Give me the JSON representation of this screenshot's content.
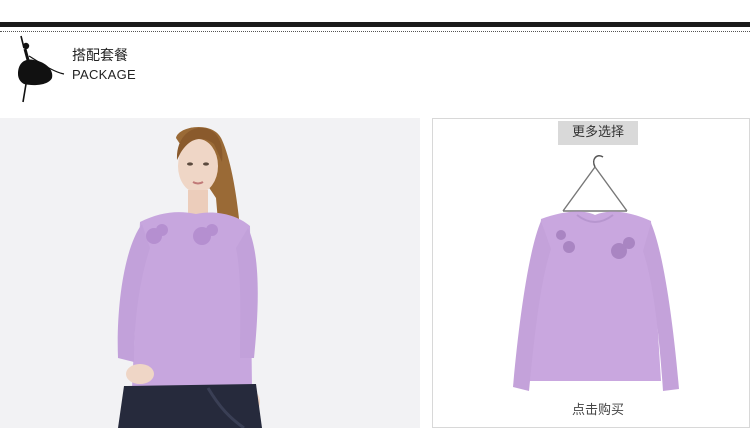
{
  "header": {
    "title_cn": "搭配套餐",
    "title_en": "PACKAGE",
    "logo_icon": "ballerina-silhouette-icon"
  },
  "model_image": {
    "icon": "model-photo",
    "garment_color": "#c7a6de"
  },
  "product_card": {
    "more_label": "更多选择",
    "buy_label": "点击购买",
    "icon": "shirt-on-hanger-photo",
    "garment_color": "#c9a7df"
  },
  "colors": {
    "bar": "#1a1a1a",
    "panel_bg": "#f2f2f4",
    "button_bg": "#d9d9d9"
  }
}
